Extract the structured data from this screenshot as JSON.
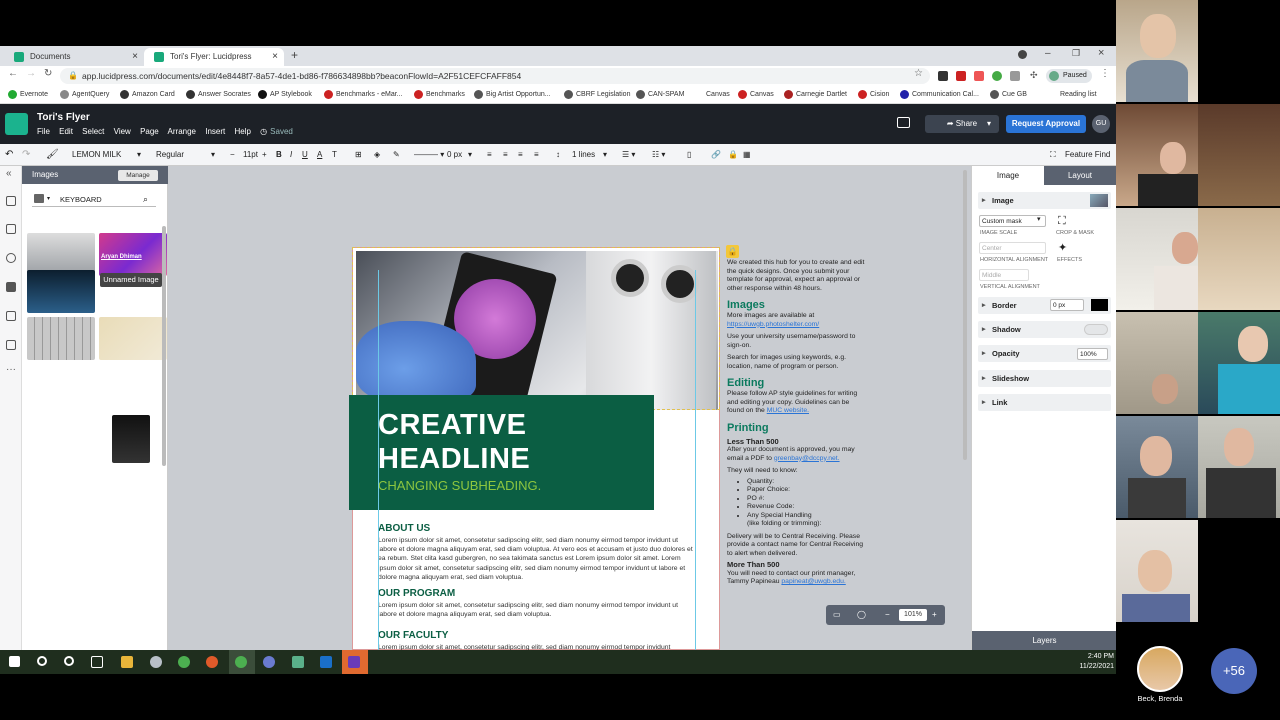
{
  "browser": {
    "tabs": [
      {
        "label": "Documents"
      },
      {
        "label": "Tori's Flyer: Lucidpress"
      }
    ],
    "url": "app.lucidpress.com/documents/edit/4e8448f7-8a57-4de1-bd86-f786634898bb?beaconFlowId=A2F51CEFCFAFF854",
    "paused": "Paused",
    "bookmarks": [
      "Evernote",
      "AgentQuery",
      "Amazon Card",
      "Answer Socrates",
      "AP Stylebook",
      "Benchmarks - eMar...",
      "Benchmarks",
      "Big Artist Opportun...",
      "CBRF Legislation",
      "CAN-SPAM",
      "Canvas",
      "Canvas",
      "Carnegie Dartlet",
      "Cision",
      "Communication Cal...",
      "Cue GB",
      "Reading list"
    ]
  },
  "app": {
    "title": "Tori's Flyer",
    "menu": [
      "File",
      "Edit",
      "Select",
      "View",
      "Page",
      "Arrange",
      "Insert",
      "Help"
    ],
    "saved": "Saved",
    "share": "Share",
    "request": "Request Approval",
    "avatar": "GU"
  },
  "toolbar": {
    "font": "LEMON MILK",
    "weight": "Regular",
    "size": "11pt",
    "stroke": "0 px",
    "lines": "1 lines",
    "feature_find": "Feature Find"
  },
  "images_panel": {
    "title": "Images",
    "manage": "Manage",
    "search": "KEYBOARD",
    "thumb_caption": "Aryan Dhiman",
    "tooltip": "Unnamed Image"
  },
  "flyer": {
    "headline1": "CREATIVE",
    "headline2": "HEADLINE",
    "subheading": "CHANGING SUBHEADING.",
    "about": "ABOUT US",
    "about_text": "Lorem ipsum dolor sit amet, consetetur sadipscing elitr, sed diam nonumy eirmod tempor invidunt ut labore et dolore magna aliquyam erat, sed diam voluptua. At vero eos et accusam et justo duo dolores et ea rebum. Stet clita kasd gubergren, no sea takimata sanctus est Lorem ipsum dolor sit amet. Lorem ipsum dolor sit amet, consetetur sadipscing elitr, sed diam nonumy eirmod tempor invidunt ut labore et dolore magna aliquyam erat, sed diam voluptua.",
    "program": "OUR PROGRAM",
    "program_text": "Lorem ipsum dolor sit amet, consetetur sadipscing elitr, sed diam nonumy eirmod tempor invidunt ut labore et dolore magna aliquyam erat, sed diam voluptua.",
    "faculty": "OUR FACULTY",
    "faculty_text": "Lorem ipsum dolor sit amet, consetetur sadipscing elitr, sed diam nonumy eirmod tempor invidunt"
  },
  "info": {
    "intro": "We created this hub for you to create and edit the quick designs. Once you submit your template for approval, expect an approval or other response within 48 hours.",
    "images_h": "Images",
    "images_t1": "More images are available at",
    "images_link": "https://uwgb.photoshelter.com/",
    "images_t2": "Use your university username/password to sign-on.",
    "images_t3": "Search for images using keywords, e.g. location, name of program or person.",
    "editing_h": "Editing",
    "editing_t": "Please follow AP style guidelines for writing and editing your copy. Guidelines can be found on the",
    "editing_link": "MUC website.",
    "printing_h": "Printing",
    "less": "Less Than 500",
    "less_t": "After your document is approved, you may email a PDF to",
    "less_link": "greenbay@dccpy.net.",
    "need": "They will need to know:",
    "list": [
      "Quantity:",
      "Paper Choice:",
      "PO #:",
      "Revenue Code:",
      "Any Special Handling"
    ],
    "list_note": "(like folding or trimming):",
    "delivery": "Delivery will be to Central Receiving. Please provide a contact name for Central Receiving to alert when delivered.",
    "more": "More Than 500",
    "more_t": "You will need to contact our print manager, Tammy Papineau",
    "more_link": "papineat@uwgb.edu."
  },
  "zoom": "101%",
  "right_panel": {
    "tabs": [
      "Image",
      "Layout"
    ],
    "image": "Image",
    "mask": "Custom mask",
    "crop": "CROP & MASK",
    "scale": "IMAGE SCALE",
    "halign_val": "Center",
    "halign": "HORIZONTAL ALIGNMENT",
    "effects": "EFFECTS",
    "valign_val": "Middle",
    "valign": "VERTICAL ALIGNMENT",
    "border": "Border",
    "border_val": "0 px",
    "shadow": "Shadow",
    "opacity": "Opacity",
    "opacity_val": "100%",
    "slideshow": "Slideshow",
    "link": "Link",
    "layers": "Layers"
  },
  "taskbar": {
    "time": "2:40 PM",
    "date": "11/22/2021"
  },
  "video": {
    "more": "+56",
    "name": "Beck, Brenda"
  },
  "colors": {
    "accent": "#1bb38e",
    "flyer_green": "#0b5e43",
    "sub_green": "#8dc63f",
    "primary": "#2a74d6"
  }
}
